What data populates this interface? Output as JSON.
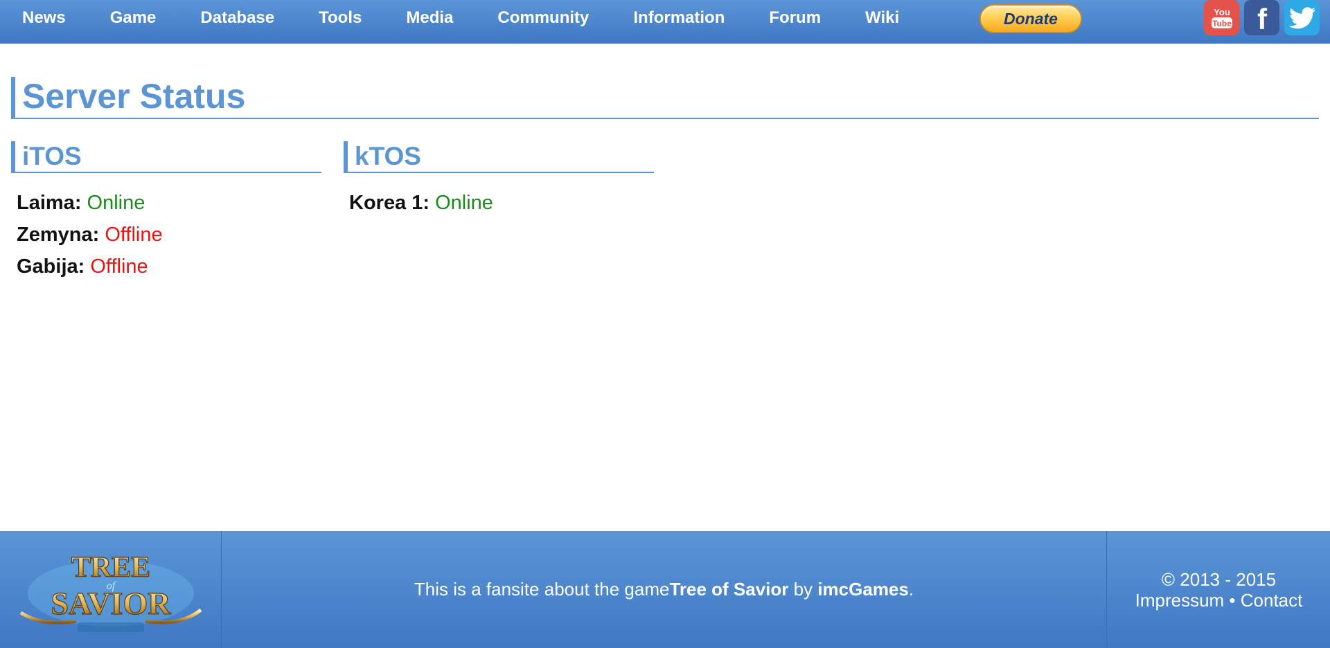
{
  "nav": {
    "items": [
      {
        "label": "News"
      },
      {
        "label": "Game"
      },
      {
        "label": "Database"
      },
      {
        "label": "Tools"
      },
      {
        "label": "Media"
      },
      {
        "label": "Community"
      },
      {
        "label": "Information"
      },
      {
        "label": "Forum"
      },
      {
        "label": "Wiki"
      }
    ],
    "donate_label": "Donate",
    "social": {
      "youtube_top": "You",
      "youtube_bottom": "Tube",
      "facebook": "f"
    }
  },
  "main": {
    "title": "Server Status",
    "regions": [
      {
        "title": "iTOS",
        "servers": [
          {
            "name": "Laima:",
            "status": "Online"
          },
          {
            "name": "Zemyna:",
            "status": "Offline"
          },
          {
            "name": "Gabija:",
            "status": "Offline"
          }
        ]
      },
      {
        "title": "kTOS",
        "servers": [
          {
            "name": "Korea 1:",
            "status": "Online"
          }
        ]
      }
    ]
  },
  "footer": {
    "logo_text_top": "TREE",
    "logo_text_of": "of",
    "logo_text_bottom": "SAVIOR",
    "text_prefix": "This is a fansite about the game",
    "game_name": "Tree of Savior",
    "text_by": " by ",
    "company": "imcGames",
    "text_suffix": ".",
    "copyright": "© 2013 - 2015",
    "impressum": "Impressum",
    "separator": " • ",
    "contact": "Contact"
  },
  "colors": {
    "accent": "#5b95d6",
    "online": "#1a8a1a",
    "offline": "#ee1111",
    "youtube": "#e4524a",
    "facebook": "#3b5a9a",
    "twitter": "#2fa9e6"
  }
}
